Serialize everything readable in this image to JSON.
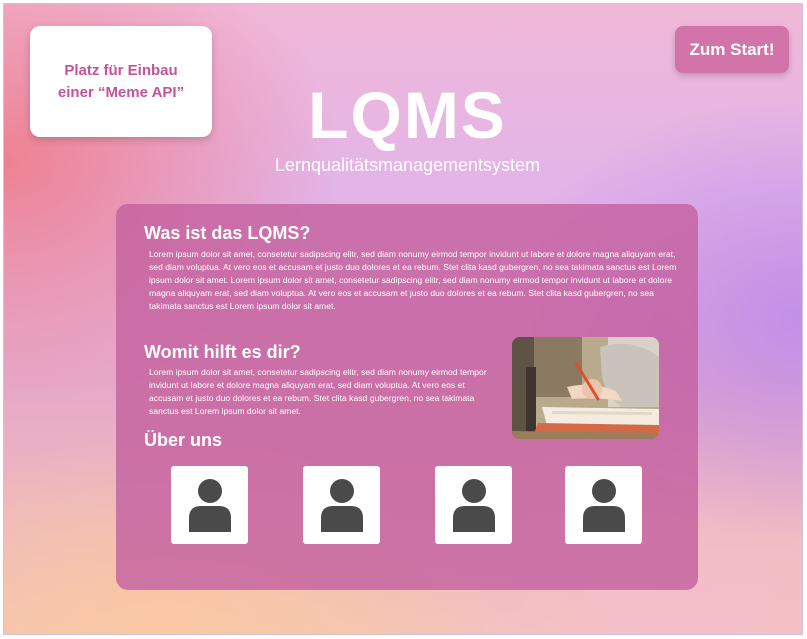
{
  "meme_box": {
    "text": "Platz für Einbau\neiner “Meme API”"
  },
  "header": {
    "start_button": "Zum Start!",
    "logo": "LQMS",
    "subtitle": "Lernqualitätsmanagementsystem"
  },
  "sections": {
    "about_title": "Was ist das LQMS?",
    "about_text": "Lorem ipsum dolor sit amet, consetetur sadipscing elitr, sed diam nonumy eirmod tempor invidunt ut labore et dolore magna aliquyam erat, sed diam voluptua. At vero eos et accusam et justo duo dolores et ea rebum. Stet clita kasd gubergren, no sea takimata sanctus est Lorem ipsum dolor sit amet. Lorem ipsum dolor sit amet, consetetur sadipscing elitr, sed diam nonumy eirmod tempor invidunt ut labore et dolore magna aliquyam erat, sed diam voluptua. At vero eos et accusam et justo duo dolores et ea rebum. Stet clita kasd gubergren, no sea takimata sanctus est Lorem ipsum dolor sit amet.",
    "help_title": "Womit hilft es dir?",
    "help_text": "Lorem ipsum dolor sit amet, consetetur sadipscing elitr, sed diam nonumy eirmod tempor invidunt ut labore et dolore magna aliquyam erat, sed diam voluptua. At vero eos et accusam et justo duo dolores et ea rebum. Stet clita kasd gubergren, no sea takimata sanctus est Lorem ipsum dolor sit amet.",
    "team_title": "Über uns"
  },
  "team": [
    {
      "icon": "user-icon"
    },
    {
      "icon": "user-icon"
    },
    {
      "icon": "user-icon"
    },
    {
      "icon": "user-icon"
    }
  ],
  "colors": {
    "accent": "#c4539a",
    "button": "#d274a9",
    "card": "#c462a0"
  }
}
